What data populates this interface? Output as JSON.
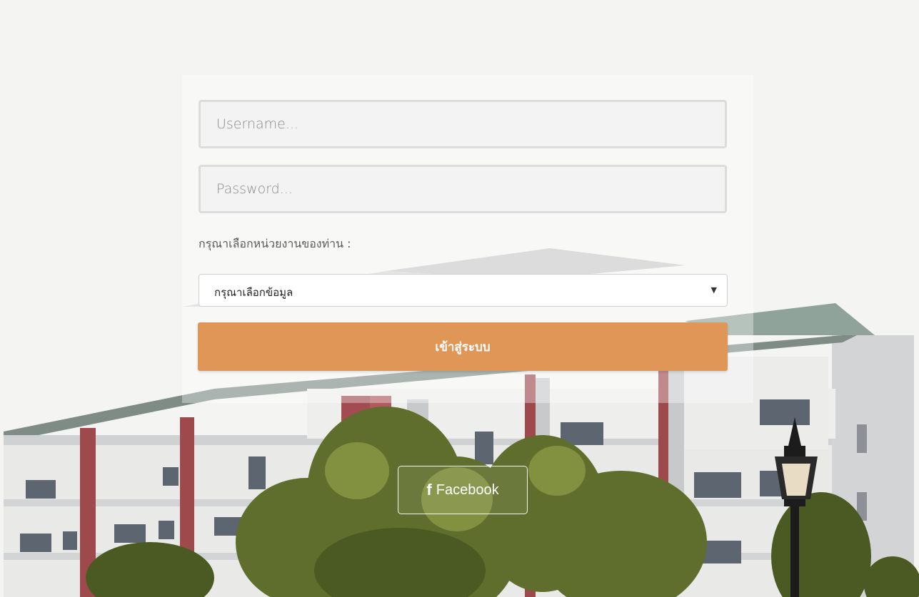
{
  "login": {
    "username_placeholder": "Username...",
    "password_placeholder": "Password...",
    "unit_label": "กรุณาเลือกหน่วยงานของท่าน :",
    "unit_select_value": "กรุณาเลือกข้อมูล",
    "submit_label": "เข้าสู่ระบบ"
  },
  "social": {
    "facebook_icon": "f",
    "facebook_label": "Facebook"
  },
  "colors": {
    "accent": "#df9657",
    "background": "#f4f4f3"
  },
  "icons": {
    "select_arrow": "▼",
    "facebook": "facebook-icon"
  }
}
